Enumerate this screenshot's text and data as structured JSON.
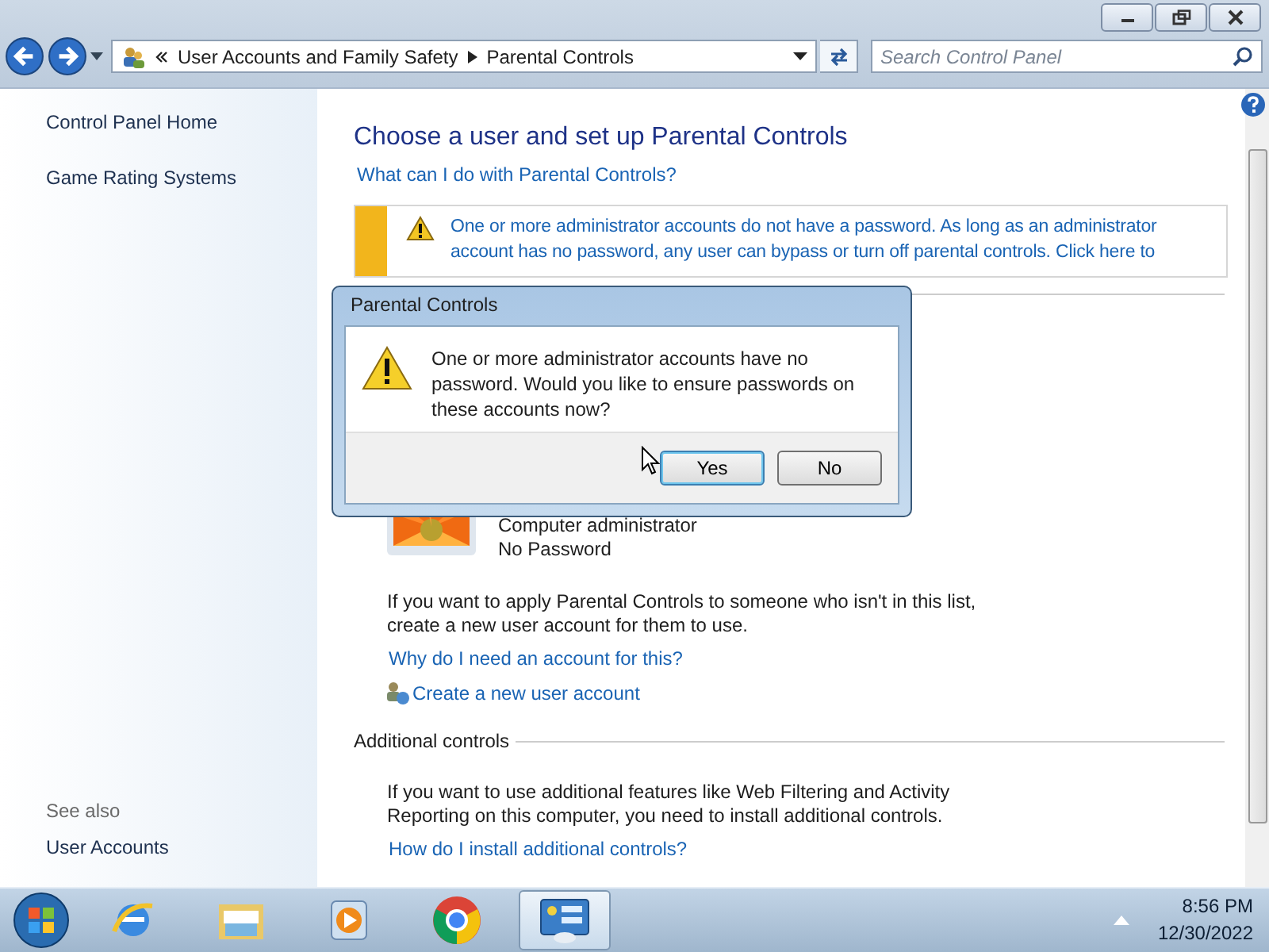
{
  "address_bar": {
    "crumbs": [
      "User Accounts and Family Safety",
      "Parental Controls"
    ]
  },
  "search": {
    "placeholder": "Search Control Panel"
  },
  "sidebar": {
    "items": [
      "Control Panel Home",
      "Game Rating Systems"
    ],
    "see_also": {
      "heading": "See also",
      "items": [
        "User Accounts"
      ]
    }
  },
  "content": {
    "title": "Choose a user and set up Parental Controls",
    "help_link": "What can I do with Parental Controls?",
    "warning": {
      "lines": [
        "One or more administrator accounts do not have a password. As long as an administrator",
        "account has no password, any user can bypass or turn off parental controls. Click here to"
      ]
    },
    "user": {
      "role": "Computer administrator",
      "password": "No Password"
    },
    "info_text": "If you want to apply Parental Controls to someone who isn't in this list, create a new user account for them to use.",
    "why_link": "Why do I need an account for this?",
    "create_link": "Create a new user account",
    "section": {
      "heading": "Additional controls",
      "text": "If you want to use additional features like Web Filtering and Activity Reporting on this computer, you need to install additional controls.",
      "link": "How do I install additional controls?"
    }
  },
  "dialog": {
    "title": "Parental Controls",
    "message": "One or more administrator accounts have no password. Would you like to ensure passwords on these accounts now?",
    "buttons": [
      {
        "label": "Yes",
        "default": true
      },
      {
        "label": "No",
        "default": false
      }
    ]
  },
  "taskbar": {
    "apps": [
      {
        "kind": "ie",
        "selected": false
      },
      {
        "kind": "explorer",
        "selected": false
      },
      {
        "kind": "media",
        "selected": false
      },
      {
        "kind": "chrome",
        "selected": false
      },
      {
        "kind": "control",
        "selected": true
      }
    ],
    "time": "8:56 PM",
    "date": "12/30/2022"
  }
}
